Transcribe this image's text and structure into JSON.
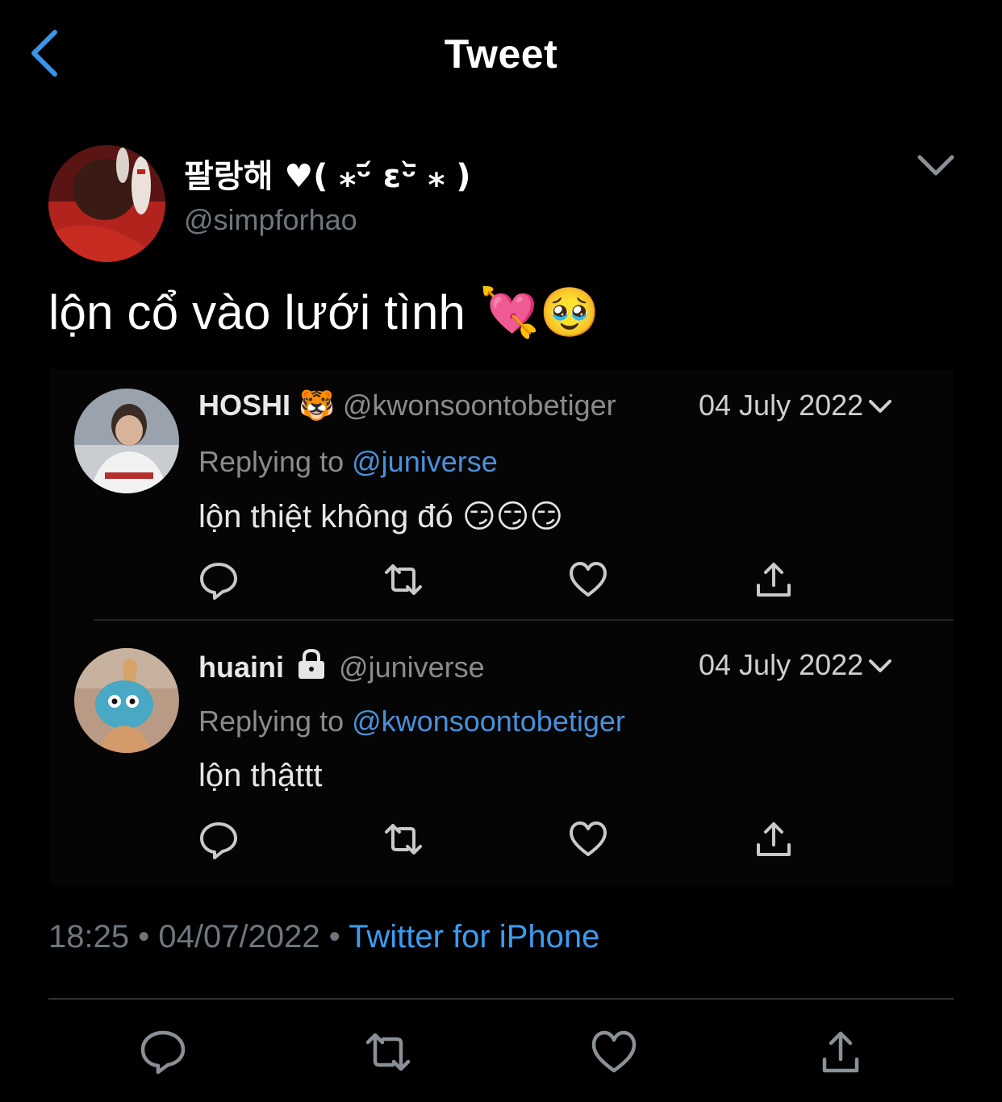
{
  "header": {
    "title": "Tweet",
    "back_icon": "chevron-left-icon",
    "accent": "#1d9bf0"
  },
  "author": {
    "display_name": "팔랑해 ♥( ⁎ᵕ᷄ ɛᵕ᷅ ⁎ )",
    "handle": "@simpforhao"
  },
  "tweet": {
    "text": "lộn cổ vào lưới tình",
    "emojis": "💘🥹"
  },
  "embedded": {
    "replies": [
      {
        "name": "HOSHI",
        "badge": "🐯",
        "handle": "@kwonsoontobetiger",
        "date": "04 July 2022",
        "replying_label": "Replying to",
        "replying_to": "@juniverse",
        "text": "lộn thiệt không đó",
        "emojis": "😏😏😏"
      },
      {
        "name": "huaini",
        "badge": "lock-icon",
        "handle": "@juniverse",
        "date": "04 July 2022",
        "replying_label": "Replying to",
        "replying_to": "@kwonsoontobetiger",
        "text": "lộn thậttt",
        "emojis": ""
      }
    ]
  },
  "meta": {
    "time": "18:25",
    "sep": "•",
    "date": "04/07/2022",
    "source": "Twitter for iPhone"
  },
  "actions": [
    "reply-icon",
    "retweet-icon",
    "like-icon",
    "share-icon"
  ]
}
